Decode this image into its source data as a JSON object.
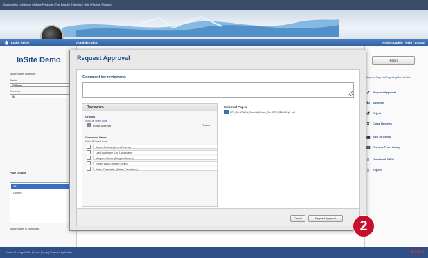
{
  "browser": {
    "tabs_text": "Bookmarks  |  Lightroom  |  Adobe Products  |  The Beach  |  Tutorials  |  Help  |  Photos  |  Support"
  },
  "nav": {
    "home_label": "InSite Home",
    "admin_label": "Administration",
    "user_links": "Robert Larkin | Help | Logout"
  },
  "left": {
    "site_title": "InSite Demo",
    "filter_label": "Show pages matching",
    "status_label": "Status",
    "status_value": "All Pages",
    "reviewer_label": "Reviewer",
    "reviewer_value": "All",
    "page_groups_label": "Page Groups",
    "groups": [
      "All",
      "Unfiled"
    ],
    "footer_text": "Show pages in composite"
  },
  "modal": {
    "title": "Request Approval",
    "comment_label": "Comment for reviewers:",
    "reviewers_header": "Reviewers",
    "groups_label": "Groups",
    "select_all_none": "Select All  Select None",
    "group_rows": [
      {
        "name": "Kodak Approver",
        "role": "Review",
        "checked": true
      }
    ],
    "customer_users_label": "Customer Users",
    "users": [
      "James Perkins (James Perkins)",
      "Lee Loughnane (Lee Loughnane)",
      "Margaret Moore (Margaret Moore)",
      "Robert Larkin (Robert Larkin)",
      "Walter Parazaider (Walter Parazaider)"
    ],
    "selected_pages_label": "Selected Pages",
    "selected_page": "V01_99-000000_Specialty/Front_Text.PDF_PROOF.p1.pdf",
    "cancel_label": "Cancel",
    "request_label": "Request Approval"
  },
  "sidebar": {
    "history_label": "History",
    "top_text": "Approve  Page List Pages  Lightbox  Details",
    "actions": [
      {
        "icon": "checkmark-icon",
        "label": "Request Approval"
      },
      {
        "icon": "approve-icon",
        "label": "Approve"
      },
      {
        "icon": "reject-icon",
        "label": "Reject"
      },
      {
        "icon": "close-reviews-icon",
        "label": "Close Reviews"
      },
      {
        "icon": "add-group-icon",
        "label": "Add To Group"
      },
      {
        "icon": "remove-group-icon",
        "label": "Remove From Group"
      },
      {
        "icon": "download-icon",
        "label": "Download JPEG"
      },
      {
        "icon": "export-icon",
        "label": "Export"
      }
    ]
  },
  "step_number": "2",
  "status_bar_text": "Kodak Prinergy InSite  |  Home  |  Help  |  Powered by Kodak",
  "brand": "Kodak"
}
